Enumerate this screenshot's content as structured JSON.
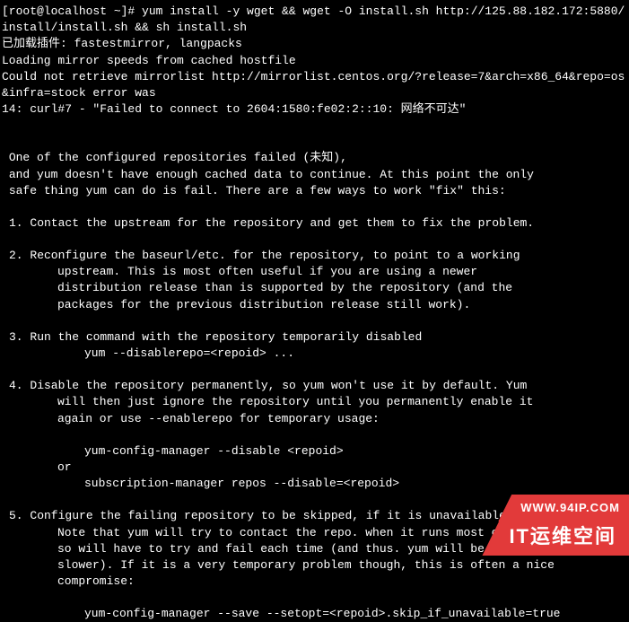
{
  "terminal": {
    "prompt": "[root@localhost ~]# ",
    "command": "yum install -y wget && wget -O install.sh http://125.88.182.172:5880/install/install.sh && sh install.sh",
    "line_plugins": "已加载插件: fastestmirror, langpacks",
    "line_loading": "Loading mirror speeds from cached hostfile",
    "line_error1": "Could not retrieve mirrorlist http://mirrorlist.centos.org/?release=7&arch=x86_64&repo=os&infra=stock error was",
    "line_error2": "14: curl#7 - \"Failed to connect to 2604:1580:fe02:2::10: 网络不可达\"",
    "msg_fail1": " One of the configured repositories failed (未知),",
    "msg_fail2": " and yum doesn't have enough cached data to continue. At this point the only",
    "msg_fail3": " safe thing yum can do is fail. There are a few ways to work \"fix\" this:",
    "item1": "1. Contact the upstream for the repository and get them to fix the problem.",
    "item2_l1": "2. Reconfigure the baseurl/etc. for the repository, to point to a working",
    "item2_l2": "upstream. This is most often useful if you are using a newer",
    "item2_l3": "distribution release than is supported by the repository (and the",
    "item2_l4": "packages for the previous distribution release still work).",
    "item3_l1": "3. Run the command with the repository temporarily disabled",
    "item3_cmd": "yum --disablerepo=<repoid> ...",
    "item4_l1": "4. Disable the repository permanently, so yum won't use it by default. Yum",
    "item4_l2": "will then just ignore the repository until you permanently enable it",
    "item4_l3": "again or use --enablerepo for temporary usage:",
    "item4_cmd1": "yum-config-manager --disable <repoid>",
    "item4_or": "or",
    "item4_cmd2": "subscription-manager repos --disable=<repoid>",
    "item5_l1": "5. Configure the failing repository to be skipped, if it is unavailable.",
    "item5_l2": "Note that yum will try to contact the repo. when it runs most commands,",
    "item5_l3": "so will have to try and fail each time (and thus. yum will be be much",
    "item5_l4": "slower). If it is a very temporary problem though, this is often a nice",
    "item5_l5": "compromise:",
    "item5_cmd": "yum-config-manager --save --setopt=<repoid>.skip_if_unavailable=true"
  },
  "logo": {
    "url_text": "WWW.94IP.COM",
    "brand_text": "IT运维空间"
  }
}
